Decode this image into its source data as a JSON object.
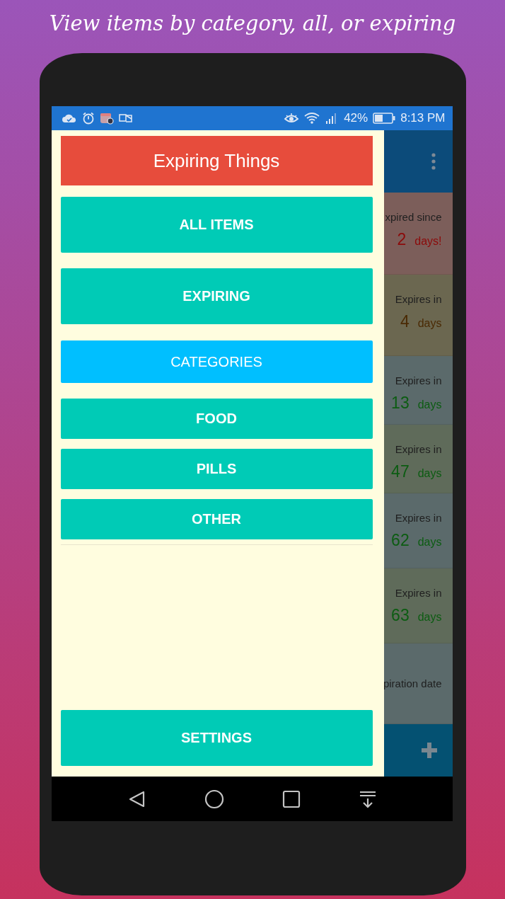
{
  "headline": "View items by category, all, or expiring",
  "status_bar": {
    "battery": "42%",
    "time": "8:13 PM"
  },
  "drawer": {
    "title": "Expiring Things",
    "items": [
      {
        "label": "ALL ITEMS",
        "kind": "primary"
      },
      {
        "label": "EXPIRING",
        "kind": "primary"
      },
      {
        "label": "CATEGORIES",
        "kind": "section"
      },
      {
        "label": "FOOD",
        "kind": "category"
      },
      {
        "label": "PILLS",
        "kind": "category"
      },
      {
        "label": "OTHER",
        "kind": "category"
      }
    ],
    "settings": "SETTINGS"
  },
  "list": {
    "rows": [
      {
        "kind": "expired",
        "status": "xpired since",
        "number": "2",
        "unit": "days!"
      },
      {
        "kind": "warning",
        "status": "Expires in",
        "number": "4",
        "unit": "days"
      },
      {
        "kind": "ok",
        "status": "Expires in",
        "number": "13",
        "unit": "days"
      },
      {
        "kind": "ok",
        "status": "Expires in",
        "number": "47",
        "unit": "days"
      },
      {
        "kind": "ok",
        "status": "Expires in",
        "number": "62",
        "unit": "days"
      },
      {
        "kind": "ok",
        "status": "Expires in",
        "number": "63",
        "unit": "days"
      },
      {
        "kind": "none",
        "status": "piration date"
      }
    ]
  }
}
